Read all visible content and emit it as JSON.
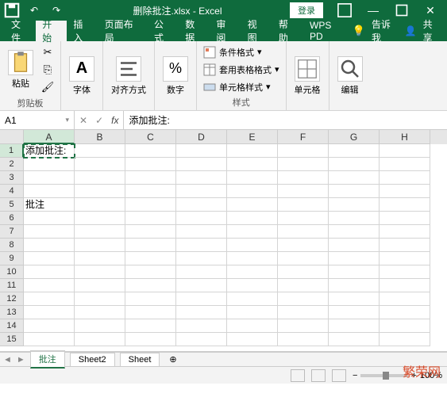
{
  "titlebar": {
    "filename": "删除批注.xlsx - Excel",
    "login": "登录"
  },
  "tabs": {
    "file": "文件",
    "home": "开始",
    "insert": "插入",
    "layout": "页面布局",
    "formulas": "公式",
    "data": "数据",
    "review": "审阅",
    "view": "视图",
    "help": "帮助",
    "wps": "WPS PD",
    "tell_me": "告诉我",
    "share": "共享"
  },
  "ribbon": {
    "paste": "粘贴",
    "clipboard_label": "剪贴板",
    "font": "字体",
    "alignment": "对齐方式",
    "number": "数字",
    "cond_format": "条件格式",
    "table_format": "套用表格格式",
    "cell_styles": "单元格样式",
    "styles_label": "样式",
    "cells": "单元格",
    "editing": "编辑"
  },
  "formula_bar": {
    "name_box": "A1",
    "value": "添加批注:"
  },
  "grid": {
    "columns": [
      "A",
      "B",
      "C",
      "D",
      "E",
      "F",
      "G",
      "H"
    ],
    "rows": [
      {
        "n": 1,
        "A": "添加批注:"
      },
      {
        "n": 2
      },
      {
        "n": 3
      },
      {
        "n": 4
      },
      {
        "n": 5,
        "A": "批注"
      },
      {
        "n": 6
      },
      {
        "n": 7
      },
      {
        "n": 8
      },
      {
        "n": 9
      },
      {
        "n": 10
      },
      {
        "n": 11
      },
      {
        "n": 12
      },
      {
        "n": 13
      },
      {
        "n": 14
      },
      {
        "n": 15
      }
    ],
    "active_cell": "A1"
  },
  "sheet_tabs": {
    "tab1": "批注",
    "tab2": "Sheet2",
    "tab3": "Sheet"
  },
  "statusbar": {
    "zoom": "100%"
  },
  "watermark": "繁荣网"
}
